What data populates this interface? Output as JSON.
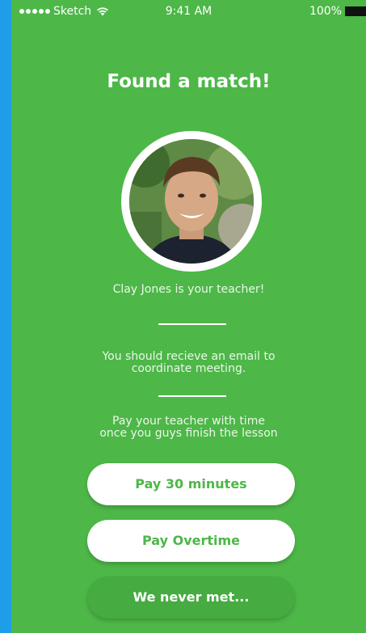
{
  "status_bar": {
    "carrier": "Sketch",
    "time": "9:41 AM",
    "battery": "100%"
  },
  "title": "Found a match!",
  "teacher_line": "Clay Jones is your teacher!",
  "email_info": {
    "line1": "You should recieve an email to",
    "line2": "coordinate meeting."
  },
  "pay_info": {
    "line1": "Pay your teacher with time",
    "line2": "once you guys finish the lesson"
  },
  "buttons": {
    "pay_30": "Pay 30 minutes",
    "pay_overtime": "Pay Overtime",
    "never_met": "We never met..."
  },
  "colors": {
    "background": "#4db748",
    "left_edge": "#1e9ee8",
    "button_white": "#ffffff",
    "button_green": "#46ab41"
  },
  "icons": [
    "signal-icon",
    "wifi-icon",
    "battery-icon"
  ]
}
